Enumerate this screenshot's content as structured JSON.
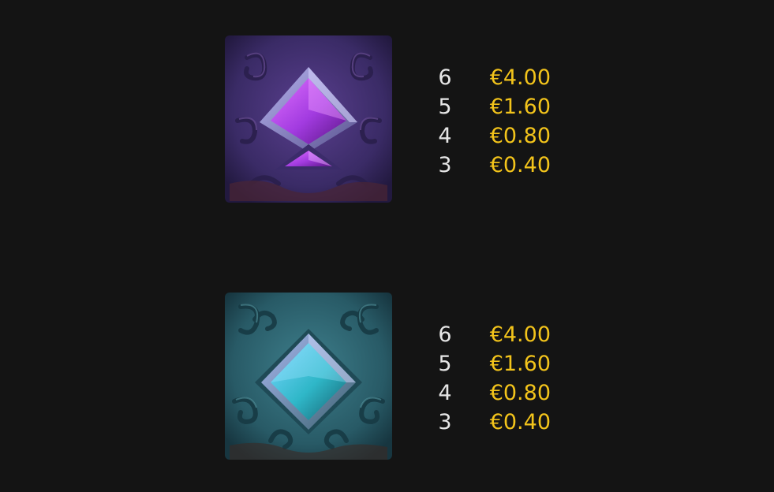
{
  "colors": {
    "background": "#141414",
    "count_text": "#e6e6e6",
    "payout_text": "#f3c41b",
    "symbol_1_gem": "#a23be0",
    "symbol_2_gem": "#2fb7c8"
  },
  "symbols": [
    {
      "icon": "purple-spade-gem-icon",
      "payouts": [
        {
          "count": "6",
          "value": "€4.00"
        },
        {
          "count": "5",
          "value": "€1.60"
        },
        {
          "count": "4",
          "value": "€0.80"
        },
        {
          "count": "3",
          "value": "€0.40"
        }
      ]
    },
    {
      "icon": "teal-diamond-gem-icon",
      "payouts": [
        {
          "count": "6",
          "value": "€4.00"
        },
        {
          "count": "5",
          "value": "€1.60"
        },
        {
          "count": "4",
          "value": "€0.80"
        },
        {
          "count": "3",
          "value": "€0.40"
        }
      ]
    }
  ]
}
